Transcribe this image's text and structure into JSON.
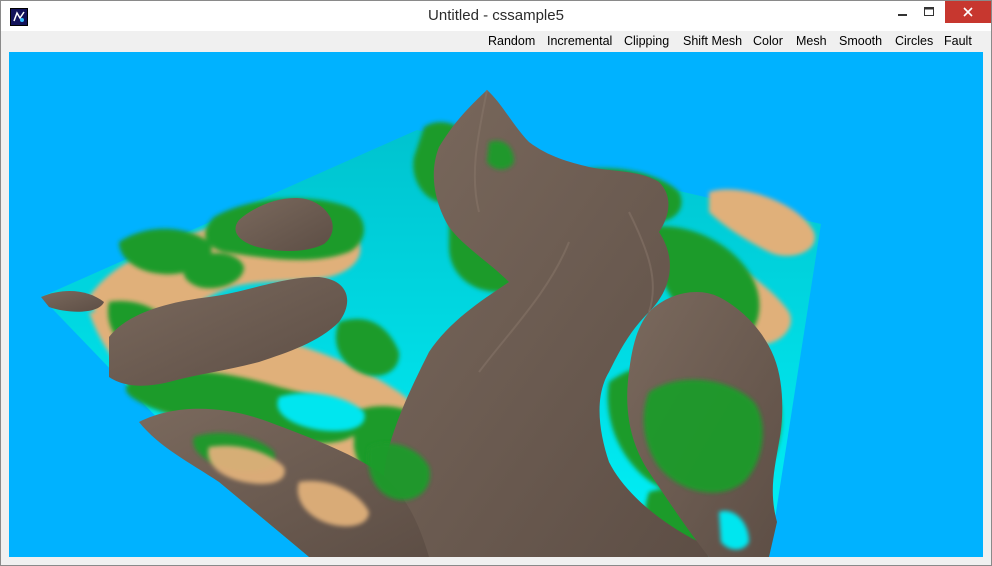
{
  "window": {
    "title": "Untitled - cssample5",
    "icon": "app-icon",
    "controls": {
      "minimize_icon": "minimize-icon",
      "maximize_icon": "maximize-icon",
      "close_icon": "close-icon"
    }
  },
  "menu": {
    "items": [
      {
        "label": "Random"
      },
      {
        "label": "Incremental"
      },
      {
        "label": "Clipping"
      },
      {
        "label": "Shift Mesh"
      },
      {
        "label": "Color"
      },
      {
        "label": "Mesh"
      },
      {
        "label": "Smooth"
      },
      {
        "label": "Circles"
      },
      {
        "label": "Fault"
      }
    ]
  },
  "viewport": {
    "background_color": "#00b2ff",
    "terrain_colors": {
      "water": "#00e6ef",
      "sand": "#e0b07a",
      "grass": "#1f9b2a",
      "rock": "#6e5d52"
    }
  }
}
